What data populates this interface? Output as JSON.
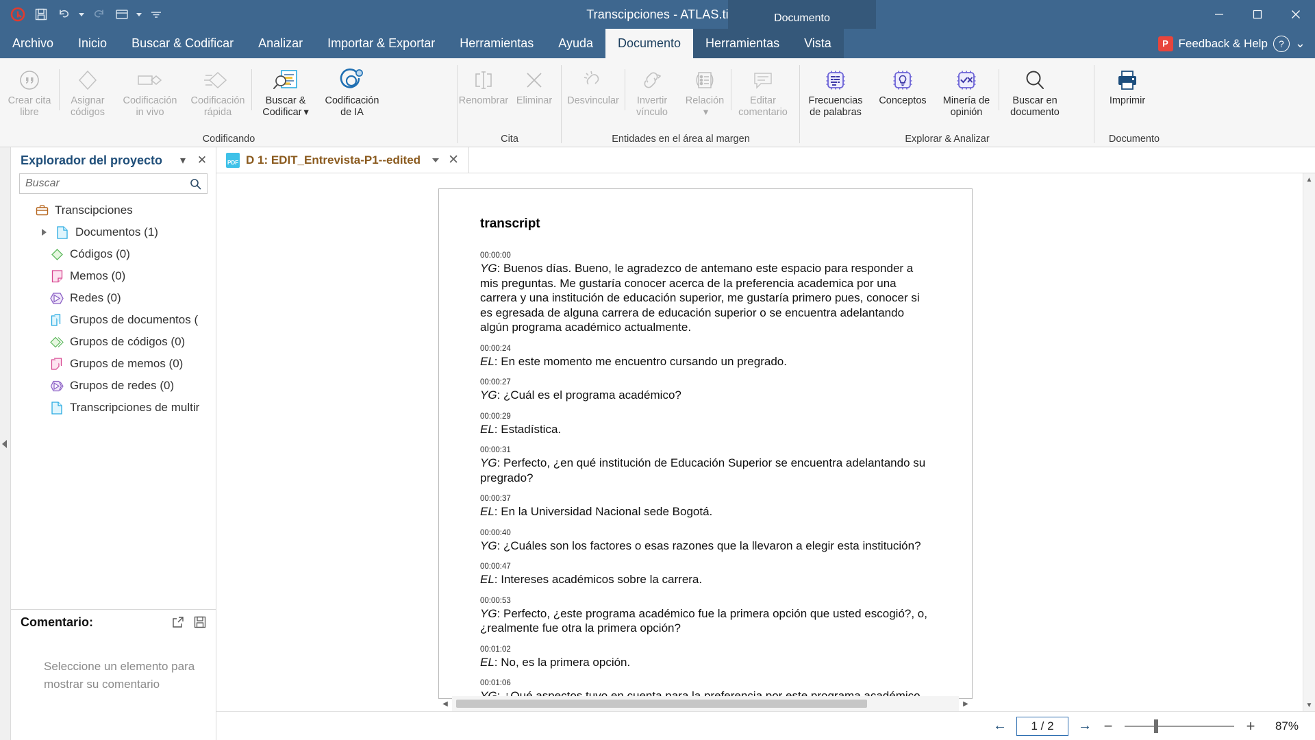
{
  "window": {
    "title": "Transcipciones - ATLAS.ti",
    "contextual_group": "Documento",
    "minimize": "─",
    "maximize": "❐",
    "close": "✕"
  },
  "quick_access": [
    {
      "name": "atlasti-logo-icon",
      "label": "ATLAS.ti"
    },
    {
      "name": "save-icon",
      "label": "Guardar"
    },
    {
      "name": "undo-icon",
      "label": "Deshacer"
    },
    {
      "name": "redo-icon",
      "label": "Rehacer"
    },
    {
      "name": "layout-icon",
      "label": "Diseño"
    },
    {
      "name": "customize-qat-icon",
      "label": "Personalizar"
    }
  ],
  "menu_tabs": [
    {
      "label": "Archivo",
      "active": false
    },
    {
      "label": "Inicio",
      "active": false
    },
    {
      "label": "Buscar & Codificar",
      "active": false
    },
    {
      "label": "Analizar",
      "active": false
    },
    {
      "label": "Importar & Exportar",
      "active": false
    },
    {
      "label": "Herramientas",
      "active": false
    },
    {
      "label": "Ayuda",
      "active": false
    },
    {
      "label": "Documento",
      "active": true,
      "contextual": true
    },
    {
      "label": "Herramientas",
      "active": false,
      "contextual": true
    },
    {
      "label": "Vista",
      "active": false,
      "contextual": true
    }
  ],
  "help_area": {
    "feedback_label": "Feedback & Help",
    "feedback_badge": "P",
    "help_glyph": "?",
    "chevron": "⌄"
  },
  "ribbon": {
    "groups": [
      {
        "label": "Codificando",
        "buttons": [
          {
            "label": "Crear cita libre",
            "icon": "quote-icon",
            "disabled": true
          },
          {
            "label": "Asignar códigos",
            "icon": "code-diamond-icon",
            "disabled": true
          },
          {
            "label": "Codificación in vivo",
            "icon": "in-vivo-code-icon",
            "disabled": true
          },
          {
            "label": "Codificación rápida",
            "icon": "quick-code-icon",
            "disabled": true
          },
          {
            "label": "Buscar & Codificar",
            "icon": "search-code-icon",
            "disabled": false,
            "dropdown": true
          },
          {
            "label": "Codificación de IA",
            "icon": "ai-coding-icon",
            "disabled": false
          }
        ]
      },
      {
        "label": "Cita",
        "buttons": [
          {
            "label": "Renombrar",
            "icon": "rename-icon",
            "disabled": true
          },
          {
            "label": "Eliminar",
            "icon": "delete-x-icon",
            "disabled": true
          }
        ]
      },
      {
        "label": "Entidades en el área al margen",
        "buttons": [
          {
            "label": "Desvincular",
            "icon": "unlink-icon",
            "disabled": true
          },
          {
            "label": "Invertir vínculo",
            "icon": "invert-link-icon",
            "disabled": true
          },
          {
            "label": "Relación",
            "icon": "relation-icon",
            "disabled": true,
            "dropdown": true
          },
          {
            "label": "Editar comentario",
            "icon": "edit-comment-icon",
            "disabled": true
          }
        ]
      },
      {
        "label": "Explorar & Analizar",
        "buttons": [
          {
            "label": "Frecuencias de palabras",
            "icon": "word-frequency-ai-icon",
            "disabled": false
          },
          {
            "label": "Conceptos",
            "icon": "concepts-ai-icon",
            "disabled": false
          },
          {
            "label": "Minería de opinión",
            "icon": "sentiment-ai-icon",
            "disabled": false
          },
          {
            "label": "Buscar en documento",
            "icon": "search-document-icon",
            "disabled": false
          }
        ]
      },
      {
        "label": "Documento",
        "buttons": [
          {
            "label": "Imprimir",
            "icon": "printer-icon",
            "disabled": false
          }
        ]
      }
    ]
  },
  "project_explorer": {
    "title": "Explorador del proyecto",
    "collapse_caret": "▾",
    "close_glyph": "✕",
    "search_placeholder": "Buscar",
    "search_value": "",
    "tree": [
      {
        "label": "Transcipciones",
        "icon": "project-briefcase-icon",
        "indent": 1,
        "expander": false
      },
      {
        "label": "Documentos (1)",
        "icon": "document-icon",
        "indent": 2,
        "expander": true
      },
      {
        "label": "Códigos (0)",
        "icon": "code-diamond-icon",
        "indent": 2,
        "expander": false
      },
      {
        "label": "Memos (0)",
        "icon": "memo-icon",
        "indent": 2,
        "expander": false
      },
      {
        "label": "Redes (0)",
        "icon": "network-icon",
        "indent": 2,
        "expander": false
      },
      {
        "label": "Grupos de documentos (",
        "icon": "document-group-icon",
        "indent": 2,
        "expander": false
      },
      {
        "label": "Grupos de códigos (0)",
        "icon": "code-group-icon",
        "indent": 2,
        "expander": false
      },
      {
        "label": "Grupos de memos (0)",
        "icon": "memo-group-icon",
        "indent": 2,
        "expander": false
      },
      {
        "label": "Grupos de redes (0)",
        "icon": "network-group-icon",
        "indent": 2,
        "expander": false
      },
      {
        "label": "Transcripciones de multir",
        "icon": "document-icon",
        "indent": 2,
        "expander": false
      }
    ]
  },
  "comment_panel": {
    "title": "Comentario:",
    "open_glyph": "↗",
    "save_glyph": "ὋE",
    "empty_text": "Seleccione un elemento para mostrar su comentario"
  },
  "document_tab": {
    "label": "D 1: EDIT_Entrevista-P1--edited",
    "icon": "pdf-icon",
    "caret": "▾",
    "close": "✕"
  },
  "document": {
    "title": "transcript",
    "segments": [
      {
        "time": "00:00:00",
        "speaker": "YG",
        "text": "Buenos días. Bueno, le agradezco de antemano este espacio para responder a mis preguntas. Me gustaría conocer acerca de la preferencia academica por una carrera y una institución de educación superior, me gustaría primero pues, conocer si es egresada de alguna carrera de educación superior o se encuentra adelantando algún programa académico actualmente."
      },
      {
        "time": "00:00:24",
        "speaker": "EL",
        "text": "En este momento me encuentro cursando un pregrado."
      },
      {
        "time": "00:00:27",
        "speaker": "YG",
        "text": "¿Cuál es el programa académico?"
      },
      {
        "time": "00:00:29",
        "speaker": "EL",
        "text": "Estadística."
      },
      {
        "time": "00:00:31",
        "speaker": "YG",
        "text": "Perfecto, ¿en qué institución de Educación Superior se encuentra adelantando su pregrado?"
      },
      {
        "time": "00:00:37",
        "speaker": "EL",
        "text": "En la Universidad Nacional sede Bogotá."
      },
      {
        "time": "00:00:40",
        "speaker": "YG",
        "text": "¿Cuáles son los factores o esas razones que la llevaron a elegir esta institución?"
      },
      {
        "time": "00:00:47",
        "speaker": "EL",
        "text": "Intereses académicos sobre la carrera."
      },
      {
        "time": "00:00:53",
        "speaker": "YG",
        "text": "Perfecto, ¿este programa académico fue la primera opción que usted escogió?, o, ¿realmente fue otra la primera opción?"
      },
      {
        "time": "00:01:02",
        "speaker": "EL",
        "text": "No, es la primera opción."
      },
      {
        "time": "00:01:06",
        "speaker": "YG",
        "text": "¿Qué aspectos tuvo en cuenta para la preferencia por este programa académico, aparte de ese factor académico que usted mencionaba?"
      }
    ]
  },
  "status_bar": {
    "prev_glyph": "←",
    "next_glyph": "→",
    "page_value": "1 / 2",
    "zoom_out": "−",
    "zoom_in": "+",
    "zoom_value": "87%"
  }
}
